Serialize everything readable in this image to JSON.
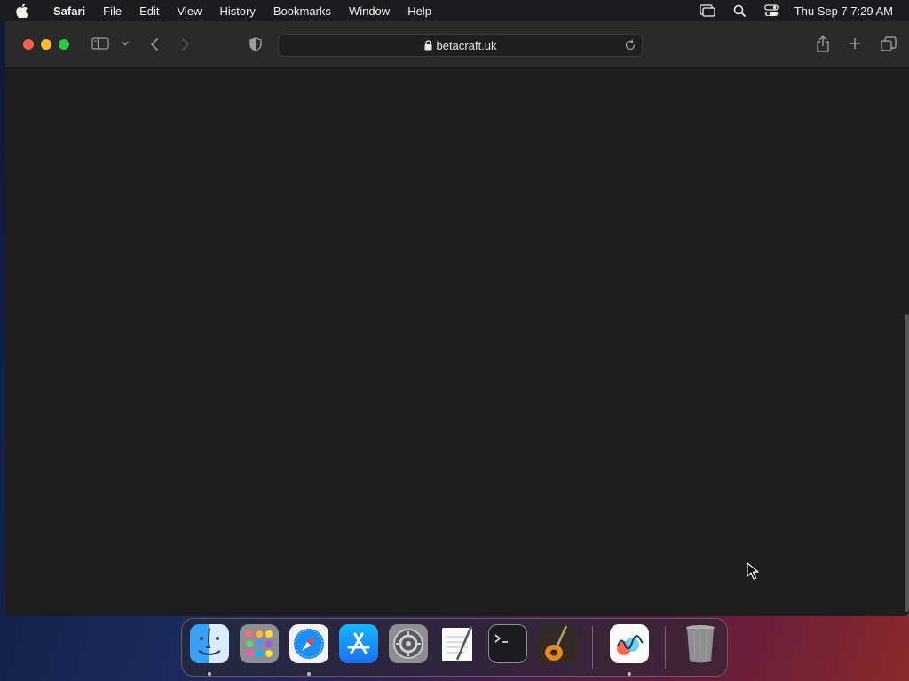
{
  "menubar": {
    "app_name": "Safari",
    "items": [
      "File",
      "Edit",
      "View",
      "History",
      "Bookmarks",
      "Window",
      "Help"
    ],
    "clock": "Thu Sep 7  7:29 AM"
  },
  "browser": {
    "url": "betacraft.uk"
  },
  "dock": {
    "apps": [
      "Finder",
      "Launchpad",
      "Safari",
      "App Store",
      "System Preferences",
      "TextEdit",
      "Terminal",
      "GarageBand",
      "Freeform",
      "Trash"
    ]
  }
}
